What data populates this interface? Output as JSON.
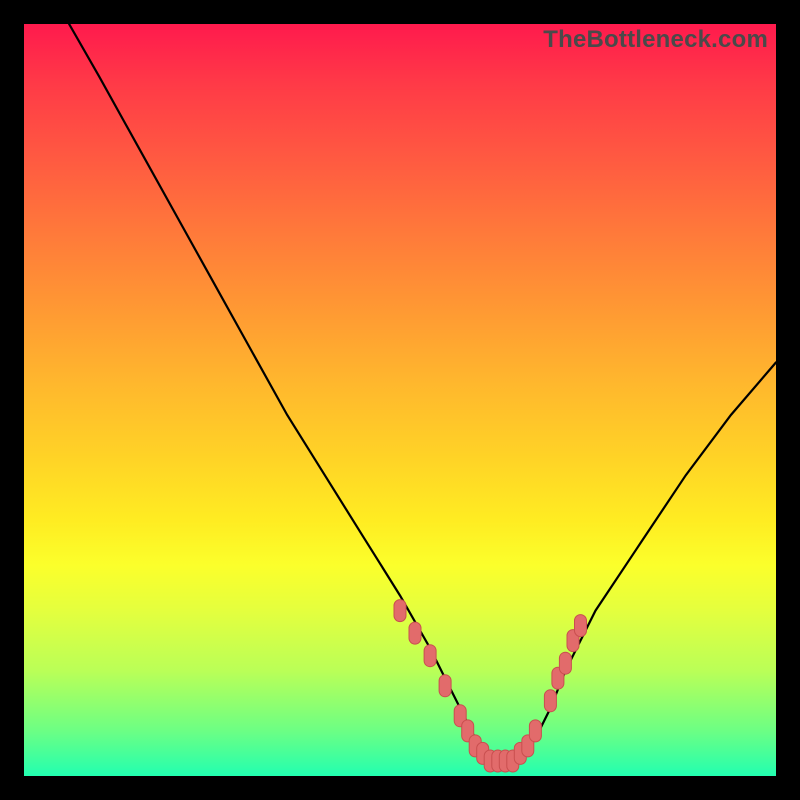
{
  "watermark": "TheBottleneck.com",
  "colors": {
    "page_bg": "#000000",
    "curve_stroke": "#000000",
    "marker_fill": "#e26b6b",
    "marker_stroke": "#c94f4f"
  },
  "chart_data": {
    "type": "line",
    "title": "",
    "xlabel": "",
    "ylabel": "",
    "xlim": [
      0,
      100
    ],
    "ylim": [
      0,
      100
    ],
    "grid": false,
    "legend": false,
    "note": "Values estimated from pixels; curve is a V-shaped bottleneck plot with minimum near x≈62. Axes are not labeled in the source image.",
    "series": [
      {
        "name": "curve",
        "x": [
          6,
          10,
          15,
          20,
          25,
          30,
          35,
          40,
          45,
          50,
          54,
          56,
          58,
          60,
          62,
          64,
          66,
          68,
          70,
          72,
          76,
          82,
          88,
          94,
          100
        ],
        "y": [
          100,
          93,
          84,
          75,
          66,
          57,
          48,
          40,
          32,
          24,
          17,
          13,
          9,
          5,
          2,
          2,
          2,
          5,
          9,
          14,
          22,
          31,
          40,
          48,
          55
        ]
      }
    ],
    "markers": {
      "name": "highlighted-range",
      "x": [
        50,
        52,
        54,
        56,
        58,
        59,
        60,
        61,
        62,
        63,
        64,
        65,
        66,
        67,
        68,
        70,
        71,
        72,
        73,
        74
      ],
      "y": [
        22,
        19,
        16,
        12,
        8,
        6,
        4,
        3,
        2,
        2,
        2,
        2,
        3,
        4,
        6,
        10,
        13,
        15,
        18,
        20
      ]
    }
  }
}
